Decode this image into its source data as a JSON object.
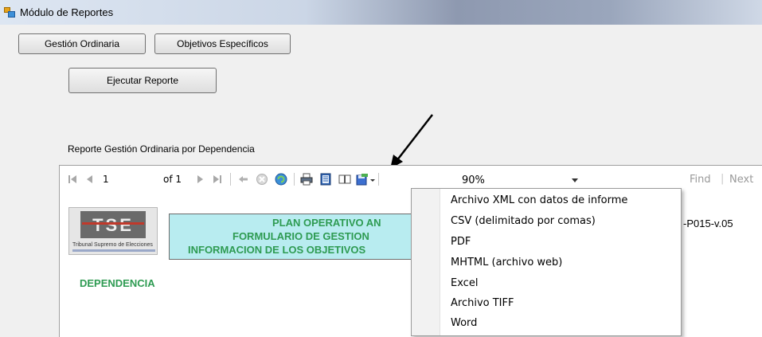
{
  "window": {
    "title": "Módulo de Reportes"
  },
  "tabs": [
    {
      "label": "Gestión Ordinaria"
    },
    {
      "label": "Objetivos Específicos"
    }
  ],
  "actions": {
    "run_label": "Ejecutar Reporte"
  },
  "report_title": "Reporte Gestión Ordinaria por Dependencia",
  "toolbar": {
    "page_current": "1",
    "page_of": "of 1",
    "zoom_value": "90%",
    "find_label": "Find",
    "next_label": "Next"
  },
  "report": {
    "code": "-P015-v.05",
    "header_lines": [
      "PLAN OPERATIVO AN",
      "FORMULARIO DE GESTION",
      "INFORMACION DE LOS OBJETIVOS"
    ],
    "dependencia_label": "DEPENDENCIA",
    "logo_text": "TSE",
    "logo_caption": "Tribunal Supremo de Elecciones"
  },
  "export_menu": {
    "items": [
      "Archivo XML con datos de informe",
      "CSV (delimitado por comas)",
      "PDF",
      "MHTML (archivo web)",
      "Excel",
      "Archivo TIFF",
      "Word"
    ]
  },
  "colors": {
    "header_fill": "#b8ecf0",
    "header_text": "#2e9b52",
    "arrow": "#000000"
  }
}
